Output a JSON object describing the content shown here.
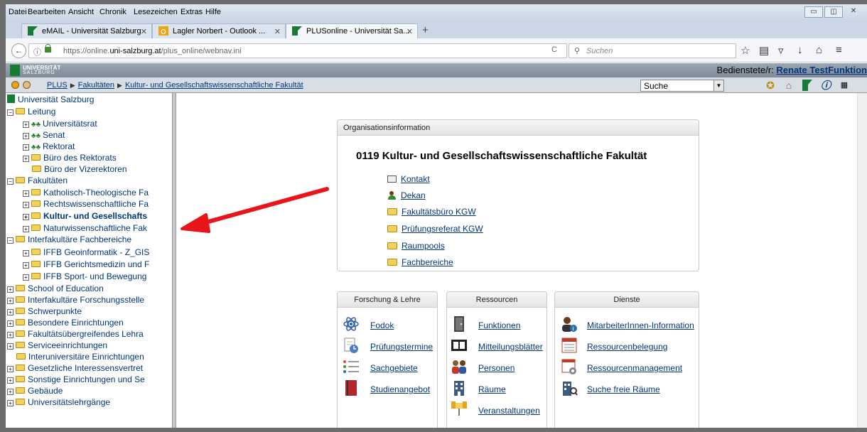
{
  "menubar": {
    "items": [
      "Datei",
      "Bearbeiten",
      "Ansicht",
      "Chronik",
      "Lesezeichen",
      "Extras",
      "Hilfe"
    ]
  },
  "tabs": [
    {
      "label": "eMAIL - Universität Salzburg"
    },
    {
      "label": "Lagler Norbert - Outlook ..."
    },
    {
      "label": "PLUSonline - Universität Sa..."
    }
  ],
  "navbar": {
    "url_prefix": "https://online.",
    "url_host": "uni-salzburg.at",
    "url_path": "/plus_online/webnav.ini",
    "search_placeholder": "Suchen"
  },
  "header": {
    "logo_line1": "UNIVERSITÄT",
    "logo_line2": "SALZBURG",
    "user_label": "Bedienstete/r:",
    "user_name": "Renate TestFunktion"
  },
  "breadcrumb": {
    "items": [
      "PLUS",
      "Fakultäten",
      "Kultur- und Gesellschaftswissenschaftliche Fakultät"
    ],
    "search_select": "Suche"
  },
  "tree": {
    "items": [
      "Universität Salzburg",
      "Leitung",
      "Universitätsrat",
      "Senat",
      "Rektorat",
      "Büro des Rektorats",
      "Büro der Vizerektoren",
      "Fakultäten",
      "Katholisch-Theologische Fa",
      "Rechtswissenschaftliche Fa",
      "Kultur- und Gesellschafts",
      "Naturwissenschaftliche Fak",
      "Interfakultäre Fachbereiche",
      "IFFB Geoinformatik - Z_GIS",
      "IFFB Gerichtsmedizin und F",
      "IFFB Sport- und Bewegung",
      "School of Education",
      "Interfakultäre Forschungsstelle",
      "Schwerpunkte",
      "Besondere Einrichtungen",
      "Fakultätsübergreifendes Lehra",
      "Serviceeinrichtungen",
      "Interuniversitäre Einrichtungen",
      "Gesetzliche Interessensvertret",
      "Sonstige Einrichtungen und Se",
      "Gebäude",
      "Universitätslehrgänge"
    ]
  },
  "org": {
    "heading": "Organisationsinformation",
    "title": "0119  Kultur- und Gesellschaftswissenschaftliche Fakultät",
    "links": [
      "Kontakt",
      "Dekan",
      "Fakultätsbüro KGW",
      "Prüfungsreferat KGW",
      "Raumpools",
      "Fachbereiche"
    ]
  },
  "sections": {
    "forschung": {
      "title": "Forschung & Lehre",
      "links": [
        "Fodok",
        "Prüfungstermine",
        "Sachgebiete",
        "Studienangebot"
      ]
    },
    "ressourcen": {
      "title": "Ressourcen",
      "links": [
        "Funktionen",
        "Mitteilungsblätter",
        "Personen",
        "Räume",
        "Veranstaltungen"
      ]
    },
    "dienste": {
      "title": "Dienste",
      "links": [
        "MitarbeiterInnen-Information",
        "Ressourcenbelegung",
        "Ressourcenmanagement",
        "Suche freie Räume"
      ]
    }
  },
  "colors": {
    "link": "#00357a",
    "annotation_arrow": "#e8151b",
    "plus_green": "#167c35"
  }
}
